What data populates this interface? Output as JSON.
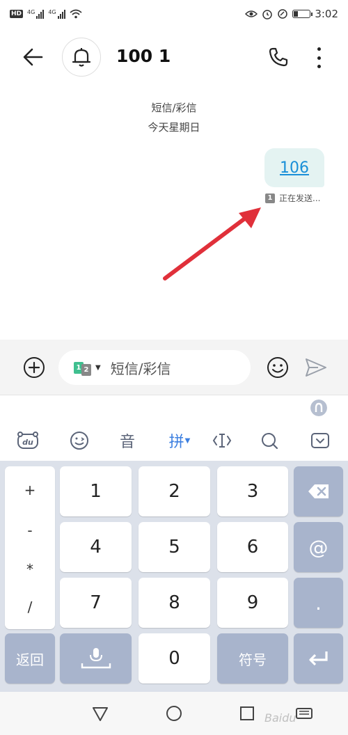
{
  "status_bar": {
    "hd_label": "HD",
    "sim1_tag": "4G",
    "sim2_tag": "4G",
    "time": "3:02",
    "battery_percent": 30
  },
  "header": {
    "title": "100 1"
  },
  "conversation": {
    "channel_label": "短信/彩信",
    "date_label": "今天星期日",
    "messages": [
      {
        "text": "106",
        "status": "正在发送...",
        "sim": "1"
      }
    ]
  },
  "composer": {
    "sim1": "1",
    "sim2": "2",
    "placeholder": "短信/彩信"
  },
  "keyboard": {
    "toolbar": {
      "brand": "du",
      "voice": "音",
      "pinyin": "拼"
    },
    "symbols": [
      "+",
      "-",
      "*",
      "/"
    ],
    "digits": [
      "1",
      "2",
      "3",
      "4",
      "5",
      "6",
      "7",
      "8",
      "9"
    ],
    "at": "@",
    "dot": ".",
    "back": "返回",
    "zero": "0",
    "symbol_key": "符号"
  },
  "watermark": "Baidu"
}
